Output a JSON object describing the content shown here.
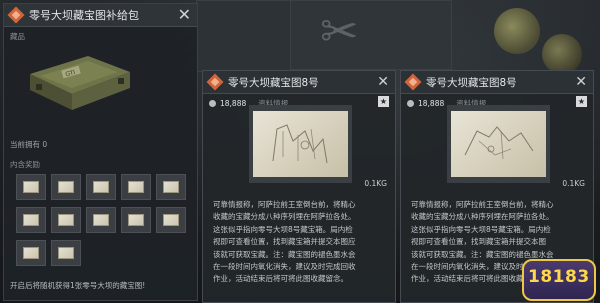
{
  "left_panel": {
    "title": "零号大坝藏宝图补给包",
    "close_icon": "✕",
    "item_label": "藏品",
    "stack_text": "当前拥有 0",
    "contents_label": "内含奖励",
    "reward_count": 12,
    "footer": "开启后将随机获得1张零号大坝的藏宝图!"
  },
  "cards": [
    {
      "title": "零号大坝藏宝图8号",
      "price": "18,888",
      "quality": "资料情报",
      "star_icon": "★",
      "weight": "0.1KG",
      "desc": [
        "可靠情报称，阿萨拉前王室倒台前，将精心",
        "收藏的宝藏分成八种序列埋在阿萨拉各处。",
        "这张似乎指向零号大坝8号藏宝箱。局内检",
        "视即可查看位置，找到藏宝箱并提交本图应",
        "该就可获取宝藏。注：藏宝图的褪色墨水会",
        "在一段时间内氧化消失，建议及时完成回收",
        "作业，活动结束后将可将此图收藏留念。"
      ]
    },
    {
      "title": "零号大坝藏宝图8号",
      "price": "18,888",
      "quality": "资料情报",
      "star_icon": "★",
      "weight": "0.1KG",
      "desc": [
        "可靠情报称，阿萨拉前王室倒台前，将精心",
        "收藏的宝藏分成八种序列埋在阿萨拉各处。",
        "这张似乎指向零号大坝8号藏宝箱。局内检",
        "视即可查看位置，找到藏宝箱并提交本图",
        "该就可获取宝藏。注：藏宝图的褪色墨水会",
        "在一段时间内氧化消失，建议及时完成回收",
        "作业，活动结束后将可将此图收藏留念。"
      ]
    }
  ],
  "watermark": "18183",
  "colors": {
    "accent": "#d0653a",
    "panel": "#1e2226",
    "text": "#c9ccd0"
  }
}
